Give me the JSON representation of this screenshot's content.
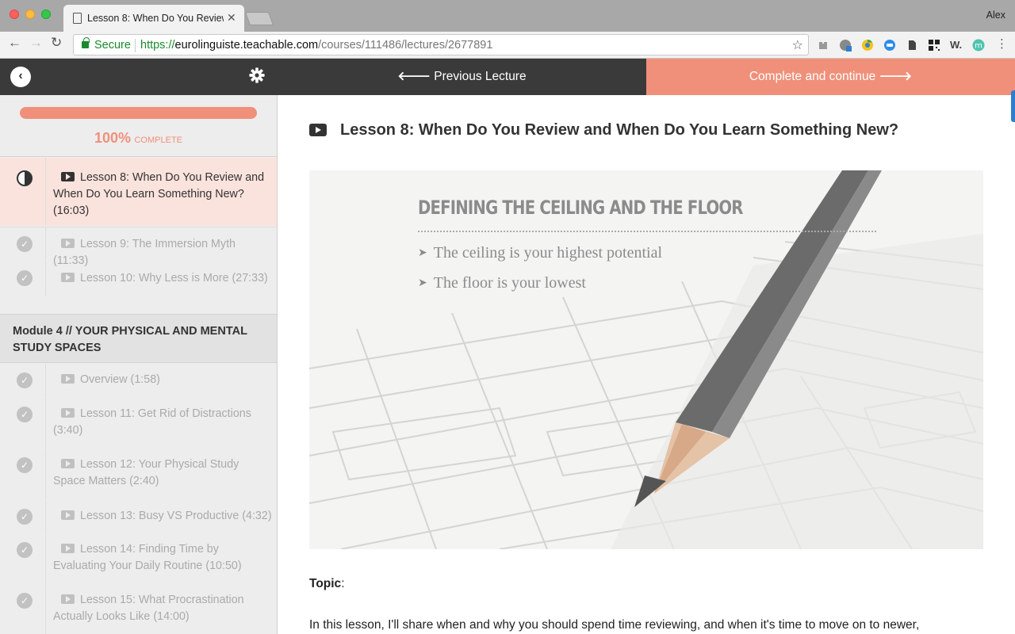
{
  "browser": {
    "tab_title": "Lesson 8: When Do You Review and When Do You Learn Something New?",
    "profile_name": "Alex",
    "secure_label": "Secure",
    "url_scheme": "https://",
    "url_host": "eurolinguiste.teachable.com",
    "url_path": "/courses/111486/lectures/2677891"
  },
  "nav": {
    "previous_label": "Previous Lecture",
    "next_label": "Complete and continue"
  },
  "progress": {
    "percent_text": "100%",
    "label": "COMPLETE",
    "fraction": 1.0
  },
  "sidebar": {
    "lessons_before": [
      {
        "title": "Lesson 8: When Do You Review and When Do You Learn Something New? (16:03)",
        "state": "active"
      },
      {
        "title": "Lesson 9: The Immersion Myth (11:33)",
        "state": "complete"
      },
      {
        "title": "Lesson 10: Why Less is More (27:33)",
        "state": "complete"
      }
    ],
    "module_title": "Module 4 // YOUR PHYSICAL AND MENTAL STUDY SPACES",
    "lessons_after": [
      {
        "title": "Overview (1:58)",
        "state": "complete"
      },
      {
        "title": "Lesson 11: Get Rid of Distractions (3:40)",
        "state": "complete"
      },
      {
        "title": "Lesson 12: Your Physical Study Space Matters (2:40)",
        "state": "complete"
      },
      {
        "title": "Lesson 13: Busy VS Productive (4:32)",
        "state": "complete"
      },
      {
        "title": "Lesson 14: Finding Time by Evaluating Your Daily Routine (10:50)",
        "state": "complete"
      },
      {
        "title": "Lesson 15: What Procrastination Actually Looks Like (14:00)",
        "state": "complete"
      }
    ]
  },
  "main": {
    "title": "Lesson 8: When Do You Review and When Do You Learn Something New?",
    "slide": {
      "heading": "DEFINING THE CEILING AND THE FLOOR",
      "bullets": [
        "The ceiling is your highest potential",
        "The floor is your lowest"
      ]
    },
    "topic_label": "Topic",
    "paragraph": "In this lesson, I'll share when and why you should spend time reviewing, and when it's time to move on to newer,"
  },
  "colors": {
    "accent": "#f0907a",
    "dark_bar": "#3a3a3a",
    "active_row": "#fbe3dd"
  }
}
